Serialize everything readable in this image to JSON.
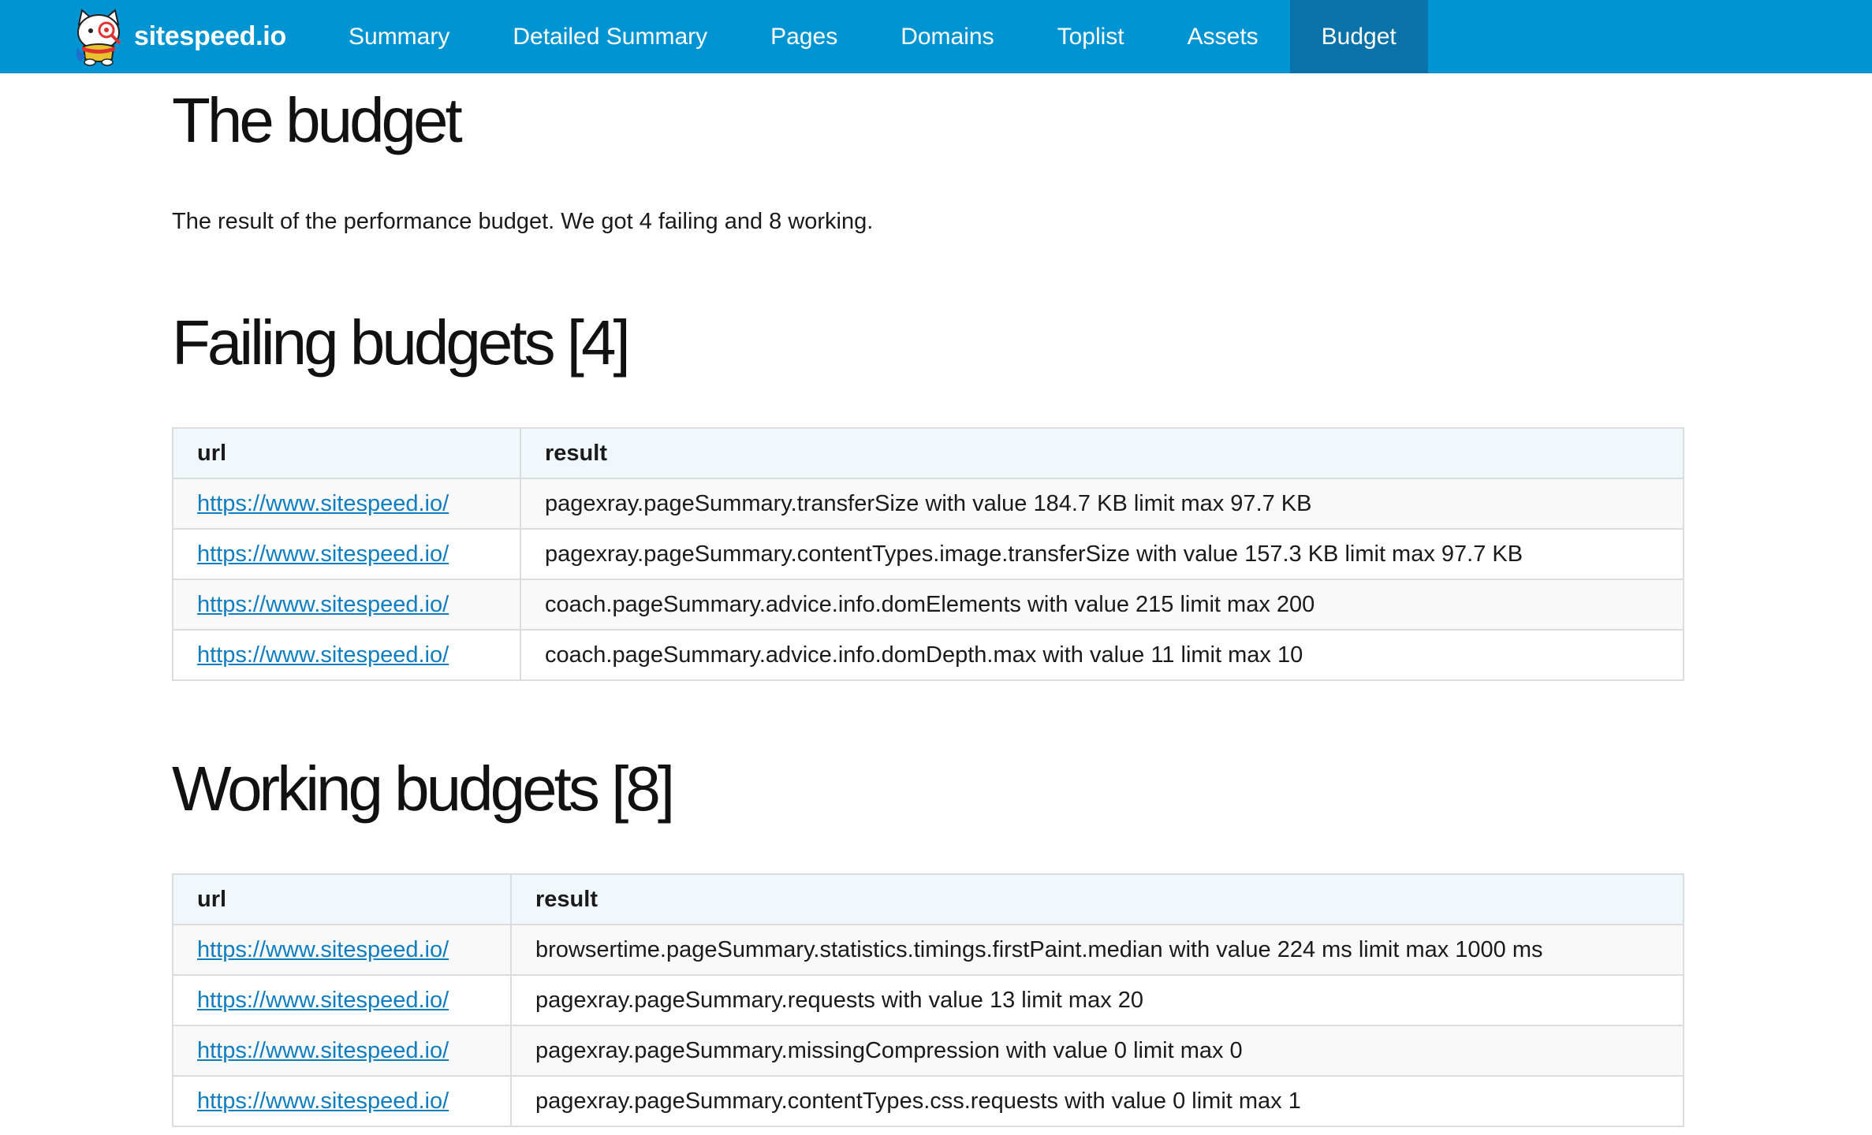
{
  "nav": {
    "brand": "sitespeed.io",
    "items": [
      {
        "label": "Summary",
        "active": false
      },
      {
        "label": "Detailed Summary",
        "active": false
      },
      {
        "label": "Pages",
        "active": false
      },
      {
        "label": "Domains",
        "active": false
      },
      {
        "label": "Toplist",
        "active": false
      },
      {
        "label": "Assets",
        "active": false
      },
      {
        "label": "Budget",
        "active": true
      }
    ],
    "colors": {
      "bar": "#0095d2",
      "active": "#0a72a8"
    }
  },
  "page": {
    "title": "The budget",
    "summary": "The result of the performance budget. We got 4 failing and 8 working."
  },
  "failing": {
    "title": "Failing budgets [4]",
    "columns": [
      "url",
      "result"
    ],
    "rows": [
      {
        "url": "https://www.sitespeed.io/",
        "result": "pagexray.pageSummary.transferSize with value 184.7 KB limit max 97.7 KB"
      },
      {
        "url": "https://www.sitespeed.io/",
        "result": "pagexray.pageSummary.contentTypes.image.transferSize with value 157.3 KB limit max 97.7 KB"
      },
      {
        "url": "https://www.sitespeed.io/",
        "result": "coach.pageSummary.advice.info.domElements with value 215 limit max 200"
      },
      {
        "url": "https://www.sitespeed.io/",
        "result": "coach.pageSummary.advice.info.domDepth.max with value 11 limit max 10"
      }
    ]
  },
  "working": {
    "title": "Working budgets [8]",
    "columns": [
      "url",
      "result"
    ],
    "rows": [
      {
        "url": "https://www.sitespeed.io/",
        "result": "browsertime.pageSummary.statistics.timings.firstPaint.median with value 224 ms limit max 1000 ms"
      },
      {
        "url": "https://www.sitespeed.io/",
        "result": "pagexray.pageSummary.requests with value 13 limit max 20"
      },
      {
        "url": "https://www.sitespeed.io/",
        "result": "pagexray.pageSummary.missingCompression with value 0 limit max 0"
      },
      {
        "url": "https://www.sitespeed.io/",
        "result": "pagexray.pageSummary.contentTypes.css.requests with value 0 limit max 1"
      }
    ]
  }
}
